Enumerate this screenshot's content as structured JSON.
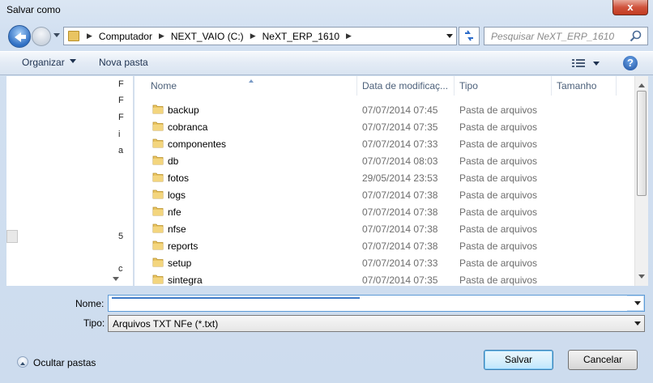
{
  "window": {
    "title": "Salvar como",
    "close_label": "x"
  },
  "address": {
    "breadcrumbs": [
      "Computador",
      "NEXT_VAIO (C:)",
      "NeXT_ERP_1610"
    ],
    "search_placeholder": "Pesquisar NeXT_ERP_1610"
  },
  "toolbar": {
    "organize_label": "Organizar",
    "new_folder_label": "Nova pasta",
    "help_label": "?"
  },
  "nav_pane": {
    "fragments": [
      "F",
      "F",
      "F",
      "i",
      "a",
      "5",
      "c"
    ]
  },
  "columns": {
    "name": "Nome",
    "date": "Data de modificaç...",
    "type": "Tipo",
    "size": "Tamanho"
  },
  "files": [
    {
      "name": "backup",
      "date": "07/07/2014 07:45",
      "type": "Pasta de arquivos"
    },
    {
      "name": "cobranca",
      "date": "07/07/2014 07:35",
      "type": "Pasta de arquivos"
    },
    {
      "name": "componentes",
      "date": "07/07/2014 07:33",
      "type": "Pasta de arquivos"
    },
    {
      "name": "db",
      "date": "07/07/2014 08:03",
      "type": "Pasta de arquivos"
    },
    {
      "name": "fotos",
      "date": "29/05/2014 23:53",
      "type": "Pasta de arquivos"
    },
    {
      "name": "logs",
      "date": "07/07/2014 07:38",
      "type": "Pasta de arquivos"
    },
    {
      "name": "nfe",
      "date": "07/07/2014 07:38",
      "type": "Pasta de arquivos"
    },
    {
      "name": "nfse",
      "date": "07/07/2014 07:38",
      "type": "Pasta de arquivos"
    },
    {
      "name": "reports",
      "date": "07/07/2014 07:38",
      "type": "Pasta de arquivos"
    },
    {
      "name": "setup",
      "date": "07/07/2014 07:33",
      "type": "Pasta de arquivos"
    },
    {
      "name": "sintegra",
      "date": "07/07/2014 07:35",
      "type": "Pasta de arquivos"
    }
  ],
  "form": {
    "name_label": "Nome:",
    "name_value": "",
    "type_label": "Tipo:",
    "type_value": "Arquivos TXT NFe (*.txt)"
  },
  "footer": {
    "hide_folders_label": "Ocultar pastas",
    "save_label": "Salvar",
    "cancel_label": "Cancelar"
  },
  "colors": {
    "accent": "#3c7fb1",
    "folder": "#e9c462",
    "close": "#c23b20"
  }
}
